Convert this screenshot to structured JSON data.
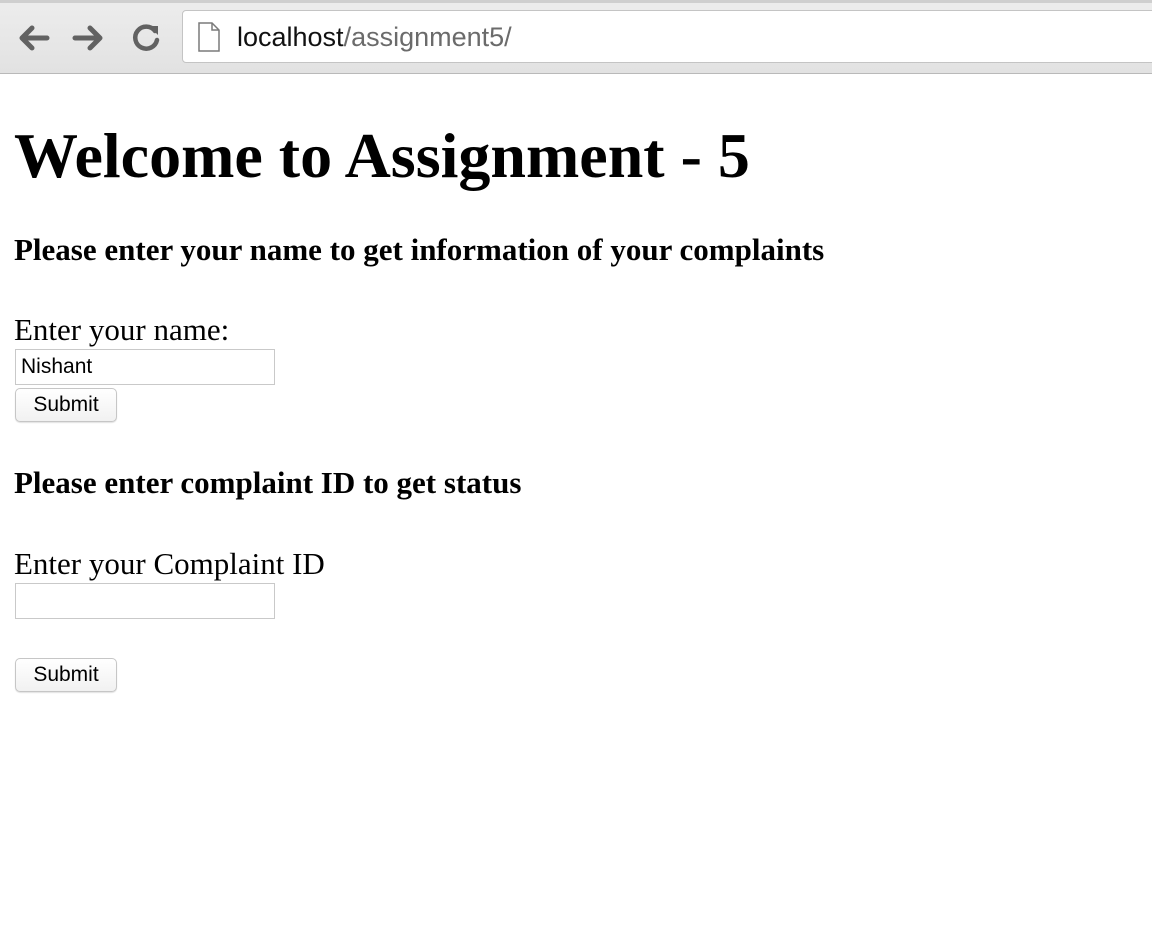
{
  "browser": {
    "url_host": "localhost",
    "url_path": "/assignment5/",
    "back_icon": "back-arrow-icon",
    "forward_icon": "forward-arrow-icon",
    "reload_icon": "reload-icon",
    "page_icon": "page-icon"
  },
  "page": {
    "title": "Welcome to Assignment - 5",
    "name_section": {
      "heading": "Please enter your name to get information of your complaints",
      "label": "Enter your name:",
      "input_value": "Nishant",
      "submit_label": "Submit"
    },
    "complaint_section": {
      "heading": "Please enter complaint ID to get status",
      "label": "Enter your Complaint ID",
      "input_value": "",
      "submit_label": "Submit"
    }
  }
}
